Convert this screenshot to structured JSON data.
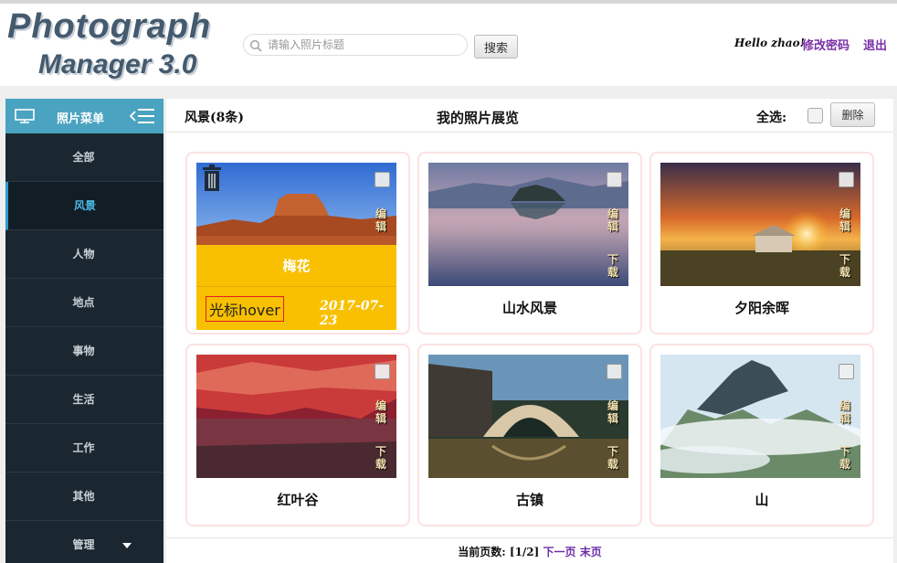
{
  "app": {
    "logo_line1": "Photograph",
    "logo_line2": "Manager 3.0"
  },
  "header": {
    "search_placeholder": "请输入照片标题",
    "search_button": "搜索",
    "greeting": "Hello zhao!",
    "change_password": "修改密码",
    "logout": "退出"
  },
  "sidebar": {
    "title": "照片菜单",
    "items": [
      {
        "label": "全部"
      },
      {
        "label": "风景",
        "active": true
      },
      {
        "label": "人物"
      },
      {
        "label": "地点"
      },
      {
        "label": "事物"
      },
      {
        "label": "生活"
      },
      {
        "label": "工作"
      },
      {
        "label": "其他"
      },
      {
        "label": "管理"
      }
    ]
  },
  "main": {
    "category_title": "风景(8条)",
    "page_title": "我的照片展览",
    "select_all": "全选:",
    "delete_button": "删除",
    "photos": [
      {
        "label": "梅花",
        "date": "2017-07-23",
        "hover_tag": "光标hover"
      },
      {
        "label": "山水风景",
        "edit": "编辑",
        "download": "下载"
      },
      {
        "label": "夕阳余晖",
        "edit": "编辑",
        "download": "下载"
      },
      {
        "label": "红叶谷",
        "edit": "编辑",
        "download": "下载"
      },
      {
        "label": "古镇",
        "edit": "编辑",
        "download": "下载"
      },
      {
        "label": "山",
        "edit": "编辑",
        "download": "下载"
      }
    ],
    "pager": {
      "current_label": "当前页数:",
      "current_value": "[1/2]",
      "next": "下一页",
      "last": "末页"
    }
  },
  "colors": {
    "accent": "#4aa3c0",
    "sidebar_bg": "#1b2730",
    "hover_bg": "#f8c000",
    "link": "#7a2fa6"
  }
}
